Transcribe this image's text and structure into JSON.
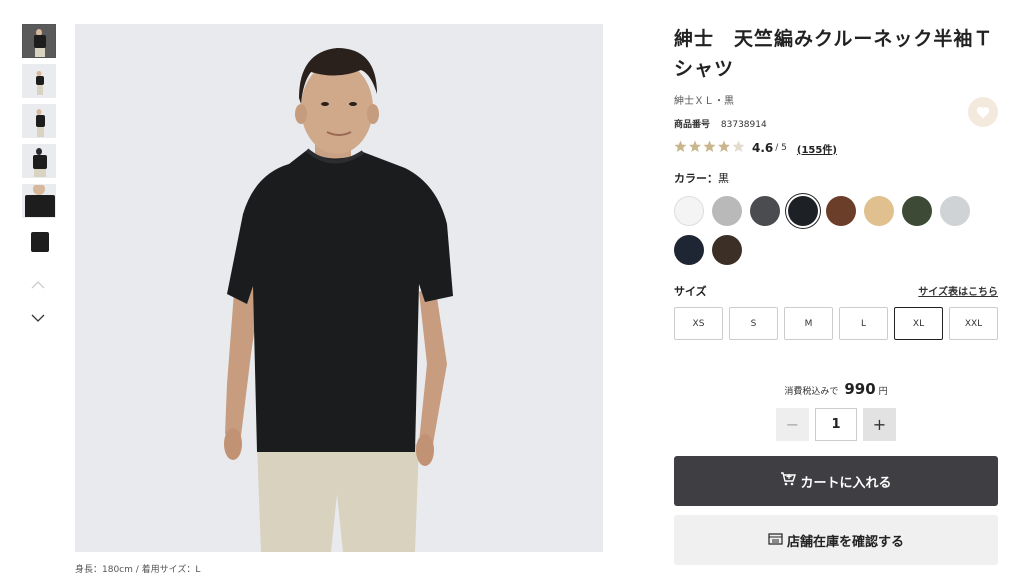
{
  "gallery": {
    "thumbnails": [
      {
        "name": "thumb-front-full"
      },
      {
        "name": "thumb-front-small"
      },
      {
        "name": "thumb-side"
      },
      {
        "name": "thumb-back"
      },
      {
        "name": "thumb-closeup"
      },
      {
        "name": "thumb-flat"
      }
    ],
    "active_index": 0,
    "up_icon": "chevron-up-icon",
    "down_icon": "chevron-down-icon",
    "caption": "身長：180cm / 着用サイズ：L"
  },
  "product": {
    "title": "紳士　天竺編みクルーネック半袖Ｔシャツ",
    "subtitle": "紳士ＸＬ・黒",
    "code_label": "商品番号",
    "code_value": "83738914",
    "rating_stars": 4.6,
    "rating_score": "4.6",
    "rating_of": "/ 5",
    "review_count": "(155件)"
  },
  "color": {
    "label": "カラー：",
    "selected": "黒",
    "swatches": [
      "#f4f4f4",
      "#b9b9b9",
      "#4a4c50",
      "#1d2126",
      "#6b3e2a",
      "#dfc08e",
      "#3c4a36",
      "#cfd3d6",
      "#1f2633",
      "#3c3026"
    ],
    "selected_index": 3
  },
  "size": {
    "label": "サイズ",
    "chart_link": "サイズ表はこちら",
    "options": [
      "XS",
      "S",
      "M",
      "L",
      "XL",
      "XXL"
    ],
    "selected_index": 4
  },
  "price": {
    "label": "消費税込みで",
    "amount": "990",
    "unit": "円"
  },
  "quantity": {
    "minus": "−",
    "value": "1",
    "plus": "+"
  },
  "actions": {
    "cart_icon": "cart-icon",
    "cart_label": "カートに入れる",
    "store_icon": "store-icon",
    "store_label": "店舗在庫を確認する"
  },
  "favorite_icon": "heart-icon"
}
